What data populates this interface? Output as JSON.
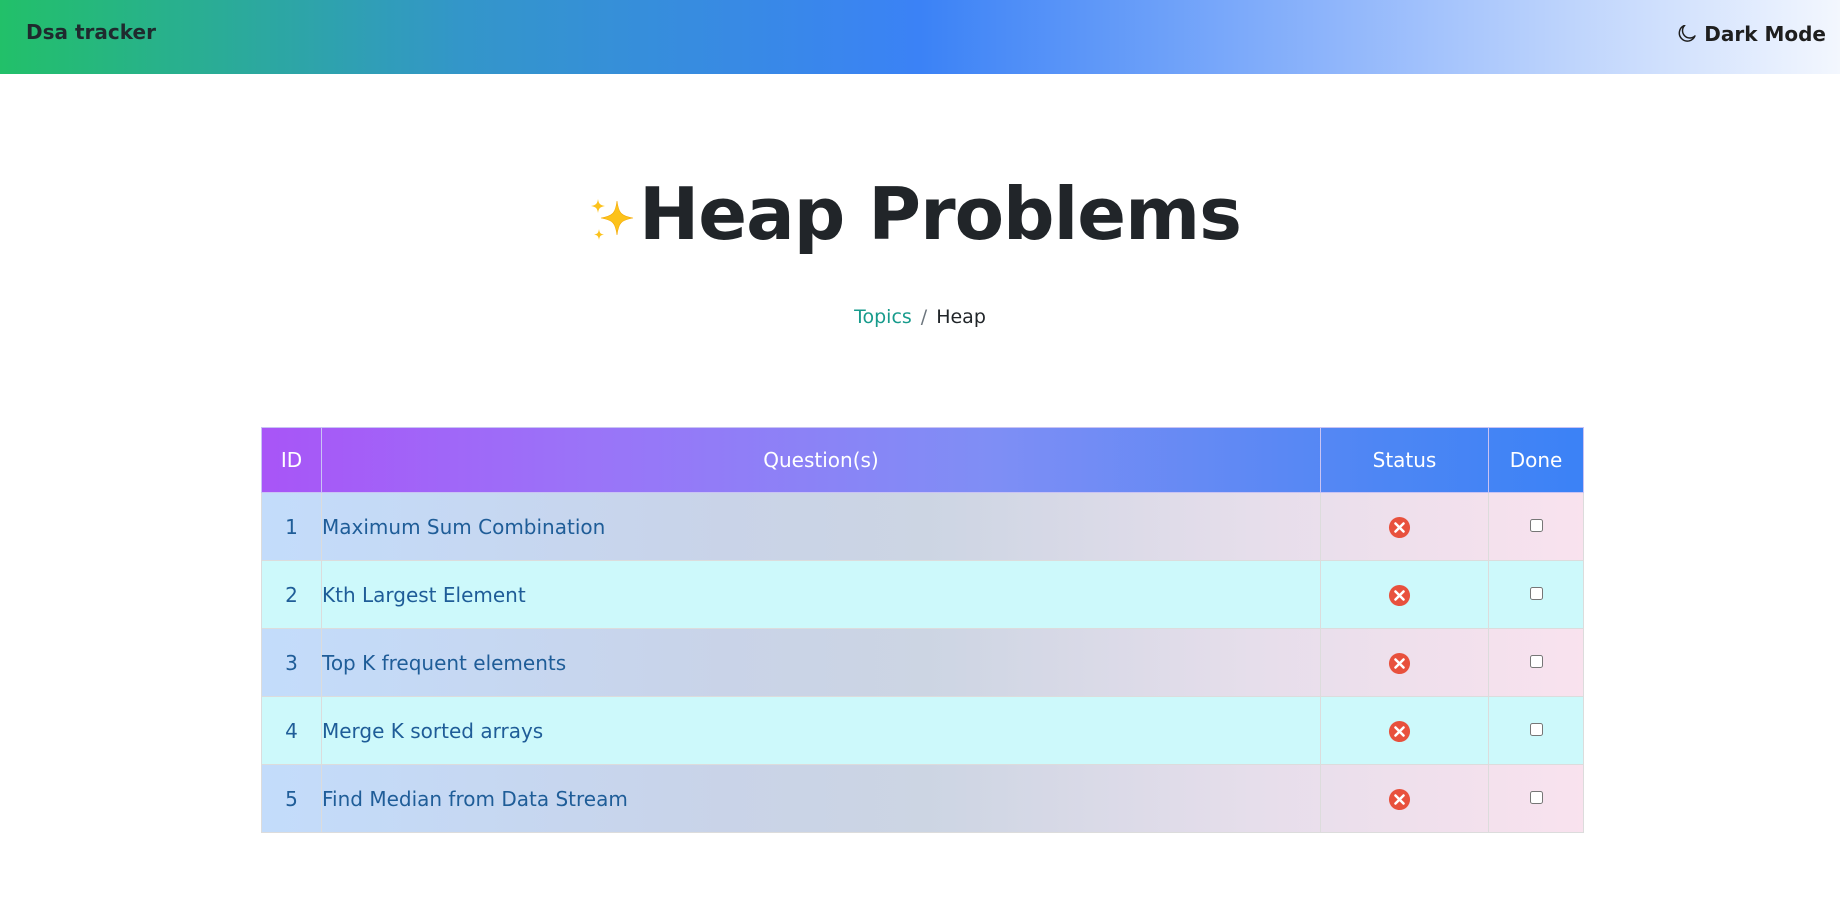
{
  "navbar": {
    "brand": "Dsa tracker",
    "dark_mode_label": "Dark Mode",
    "dark_mode_icon": "moon-icon",
    "gradient_colors": [
      "#22c069",
      "#3b82f6",
      "#f3f7fe"
    ]
  },
  "page": {
    "title": "Heap Problems",
    "title_icon": "sparkles-icon"
  },
  "breadcrumb": {
    "items": [
      {
        "label": "Topics",
        "is_link": true
      },
      {
        "label": "Heap",
        "is_link": false
      }
    ],
    "separator": "/"
  },
  "table": {
    "headers": [
      "ID",
      "Question(s)",
      "Status",
      "Done"
    ],
    "status_icon": "x-circle-icon",
    "status_color": "#e8513d",
    "rows": [
      {
        "id": "1",
        "question": "Maximum Sum Combination",
        "status": "not-done",
        "done": false
      },
      {
        "id": "2",
        "question": "Kth Largest Element",
        "status": "not-done",
        "done": false
      },
      {
        "id": "3",
        "question": "Top K frequent elements",
        "status": "not-done",
        "done": false
      },
      {
        "id": "4",
        "question": "Merge K sorted arrays",
        "status": "not-done",
        "done": false
      },
      {
        "id": "5",
        "question": "Find Median from Data Stream",
        "status": "not-done",
        "done": false
      }
    ]
  }
}
